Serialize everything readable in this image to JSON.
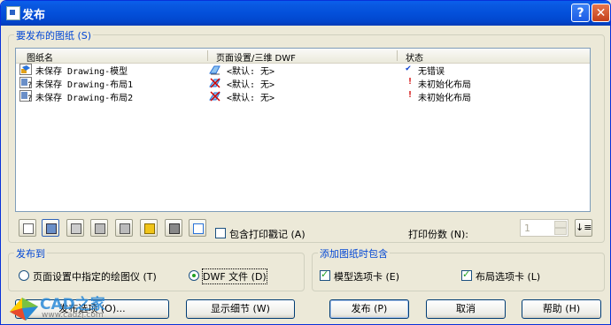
{
  "window": {
    "title": "发布",
    "help": "?",
    "close": "✕"
  },
  "sheets_group": {
    "label": "要发布的图纸 (S)"
  },
  "columns": [
    "图纸名",
    "页面设置/三维 DWF",
    "状态"
  ],
  "rows": [
    {
      "name": "未保存 Drawing-模型",
      "setup": "<默认: 无>",
      "status_mark": "✔",
      "status": "无错误",
      "status_color": "#0a3fcf"
    },
    {
      "name": "未保存 Drawing-布局1",
      "setup": "<默认: 无>",
      "status_mark": "!",
      "status": "未初始化布局",
      "status_color": "#d00000"
    },
    {
      "name": "未保存 Drawing-布局2",
      "setup": "<默认: 无>",
      "status_mark": "!",
      "status": "未初始化布局",
      "status_color": "#d00000"
    }
  ],
  "toolbar": {
    "icons": [
      "preview-icon",
      "add-sheets-icon",
      "remove-sheets-icon",
      "move-up-icon",
      "move-down-icon",
      "load-list-icon",
      "save-list-icon",
      "plot-stamp-settings-icon"
    ],
    "include_stamp": "包含打印戳记 (A)",
    "copies_label": "打印份数 (N):",
    "copies_value": "1"
  },
  "publish_to": {
    "label": "发布到",
    "option1": "页面设置中指定的绘图仪 (T)",
    "option2": "DWF 文件 (D)",
    "selected": "DWF 文件 (D)"
  },
  "include": {
    "label": "添加图纸时包含",
    "model_tab": "模型选项卡 (E)",
    "layout_tab": "布局选项卡 (L)"
  },
  "buttons": {
    "publish_options": "发布选项 (O)...",
    "show_details": "显示细节 (W)",
    "publish": "发布 (P)",
    "cancel": "取消",
    "help": "帮助 (H)"
  },
  "watermark": {
    "brand": "CAD之家",
    "url": "www.cadzj.com"
  },
  "colors": {
    "title_bar": "#0350da",
    "group_label": "#0046d5",
    "ok": "#0a3fcf",
    "error": "#d00000"
  }
}
